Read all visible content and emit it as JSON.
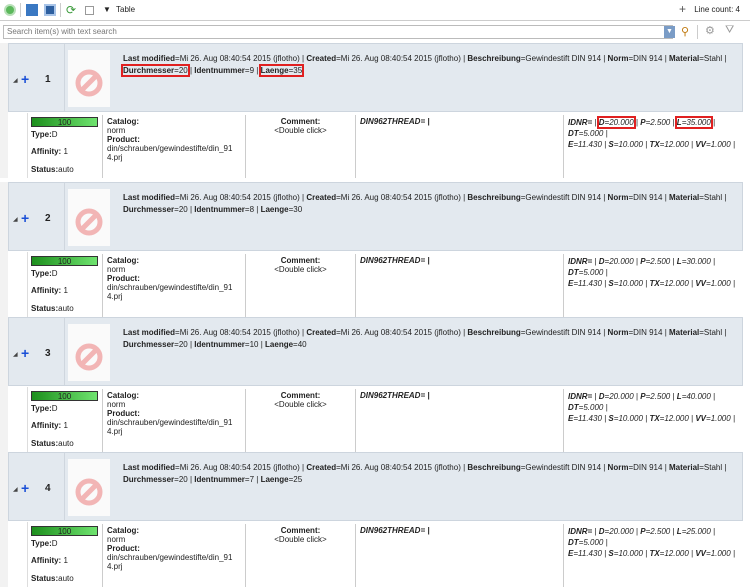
{
  "toolbar": {
    "view_label": "Table",
    "line_count": "Line count: 4",
    "icons": [
      "add-icon",
      "export-icon",
      "report-icon",
      "refresh-icon",
      "collapse-icon",
      "view-dropdown-icon",
      "plus-icon",
      "search-filter-icon",
      "settings-icon",
      "filter-icon"
    ]
  },
  "search": {
    "placeholder": "Search item(s) with text search"
  },
  "colors": {
    "highlight": "#e02020",
    "row_bg": "#e3e9ef",
    "bar": "#3cb83c"
  },
  "rows": [
    {
      "num": "1",
      "last_modified": "Mi 26. Aug 08:40:54 2015 (jflotho)",
      "created": "Mi 26. Aug 08:40:54 2015 (jflotho)",
      "beschreibung": "Gewindestift DIN 914",
      "norm": "DIN 914",
      "material": "Stahl",
      "durchmesser": "20",
      "identnummer": "9",
      "laenge": "35",
      "L": "35.000",
      "highlight": true
    },
    {
      "num": "2",
      "last_modified": "Mi 26. Aug 08:40:54 2015 (jflotho)",
      "created": "Mi 26. Aug 08:40:54 2015 (jflotho)",
      "beschreibung": "Gewindestift DIN 914",
      "norm": "DIN 914",
      "material": "Stahl",
      "durchmesser": "20",
      "identnummer": "8",
      "laenge": "30",
      "L": "30.000",
      "highlight": false
    },
    {
      "num": "3",
      "last_modified": "Mi 26. Aug 08:40:54 2015 (jflotho)",
      "created": "Mi 26. Aug 08:40:54 2015 (jflotho)",
      "beschreibung": "Gewindestift DIN 914",
      "norm": "DIN 914",
      "material": "Stahl",
      "durchmesser": "20",
      "identnummer": "10",
      "laenge": "40",
      "L": "40.000",
      "highlight": false
    },
    {
      "num": "4",
      "last_modified": "Mi 26. Aug 08:40:54 2015 (jflotho)",
      "created": "Mi 26. Aug 08:40:54 2015 (jflotho)",
      "beschreibung": "Gewindestift DIN 914",
      "norm": "DIN 914",
      "material": "Stahl",
      "durchmesser": "20",
      "identnummer": "7",
      "laenge": "25",
      "L": "25.000",
      "highlight": false
    }
  ],
  "detail": {
    "score": "100",
    "type": "D",
    "affinity": "1",
    "status": "auto",
    "catalog": "norm",
    "product": "din/schrauben/gewindestifte/din_914.prj",
    "comment": "<Double click>",
    "thread": "DIN962THREAD= |",
    "D": "20.000",
    "P": "2.500",
    "DT": "5.000",
    "E": "11.430",
    "S": "10.000",
    "TX": "12.000",
    "VV": "1.000"
  },
  "labels": {
    "last_modified": "Last modified",
    "created": "Created",
    "beschreibung": "Beschreibung",
    "norm": "Norm",
    "material": "Material",
    "durchmesser": "Durchmesser",
    "identnummer": "Identnummer",
    "laenge": "Laenge",
    "type": "Type:",
    "affinity": "Affinity:",
    "status": "Status:",
    "catalog": "Catalog:",
    "product": "Product:",
    "comment": "Comment:"
  }
}
